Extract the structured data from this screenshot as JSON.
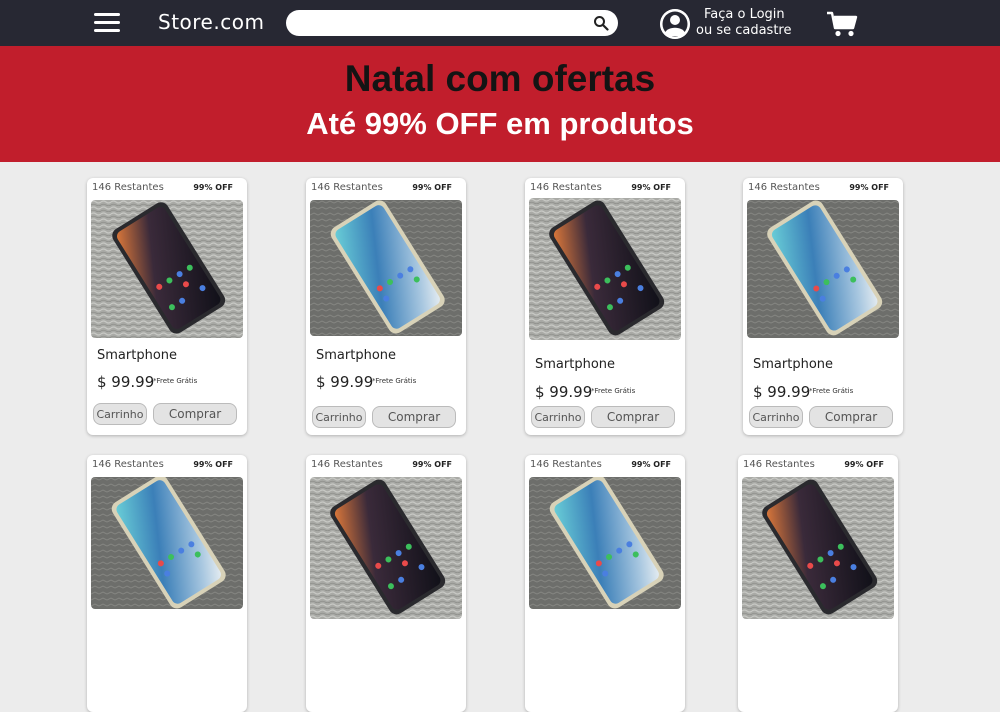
{
  "nav": {
    "brand": "Store.com",
    "search_placeholder": "",
    "login_line1": "Faça o Login",
    "login_line2": "ou se cadastre"
  },
  "banner": {
    "title": "Natal com ofertas",
    "subtitle": "Até 99% OFF em produtos"
  },
  "colors": {
    "nav_bg": "#272833",
    "banner_bg": "#c11e2c"
  },
  "products": [
    {
      "stock": "146 Restantes",
      "discount": "99% OFF",
      "name": "Smartphone",
      "price": "$ 99.99",
      "shipping": "*Frete Grátis",
      "cart_label": "Carrinho",
      "buy_label": "Comprar",
      "image": "phone-dark-screen"
    },
    {
      "stock": "146 Restantes",
      "discount": "99% OFF",
      "name": "Smartphone",
      "price": "$ 99.99",
      "shipping": "*Frete Grátis",
      "cart_label": "Carrinho",
      "buy_label": "Comprar",
      "image": "phone-blue-screen"
    },
    {
      "stock": "146 Restantes",
      "discount": "99% OFF",
      "name": "Smartphone",
      "price": "$ 99.99",
      "shipping": "*Frete Grátis",
      "cart_label": "Carrinho",
      "buy_label": "Comprar",
      "image": "phone-dark-screen"
    },
    {
      "stock": "146 Restantes",
      "discount": "99% OFF",
      "name": "Smartphone",
      "price": "$ 99.99",
      "shipping": "*Frete Grátis",
      "cart_label": "Carrinho",
      "buy_label": "Comprar",
      "image": "phone-blue-screen"
    },
    {
      "stock": "146 Restantes",
      "discount": "99% OFF",
      "image": "phone-blue-screen"
    },
    {
      "stock": "146 Restantes",
      "discount": "99% OFF",
      "image": "phone-dark-screen"
    },
    {
      "stock": "146 Restantes",
      "discount": "99% OFF",
      "image": "phone-blue-screen"
    },
    {
      "stock": "146 Restantes",
      "discount": "99% OFF",
      "image": "phone-dark-screen"
    }
  ]
}
